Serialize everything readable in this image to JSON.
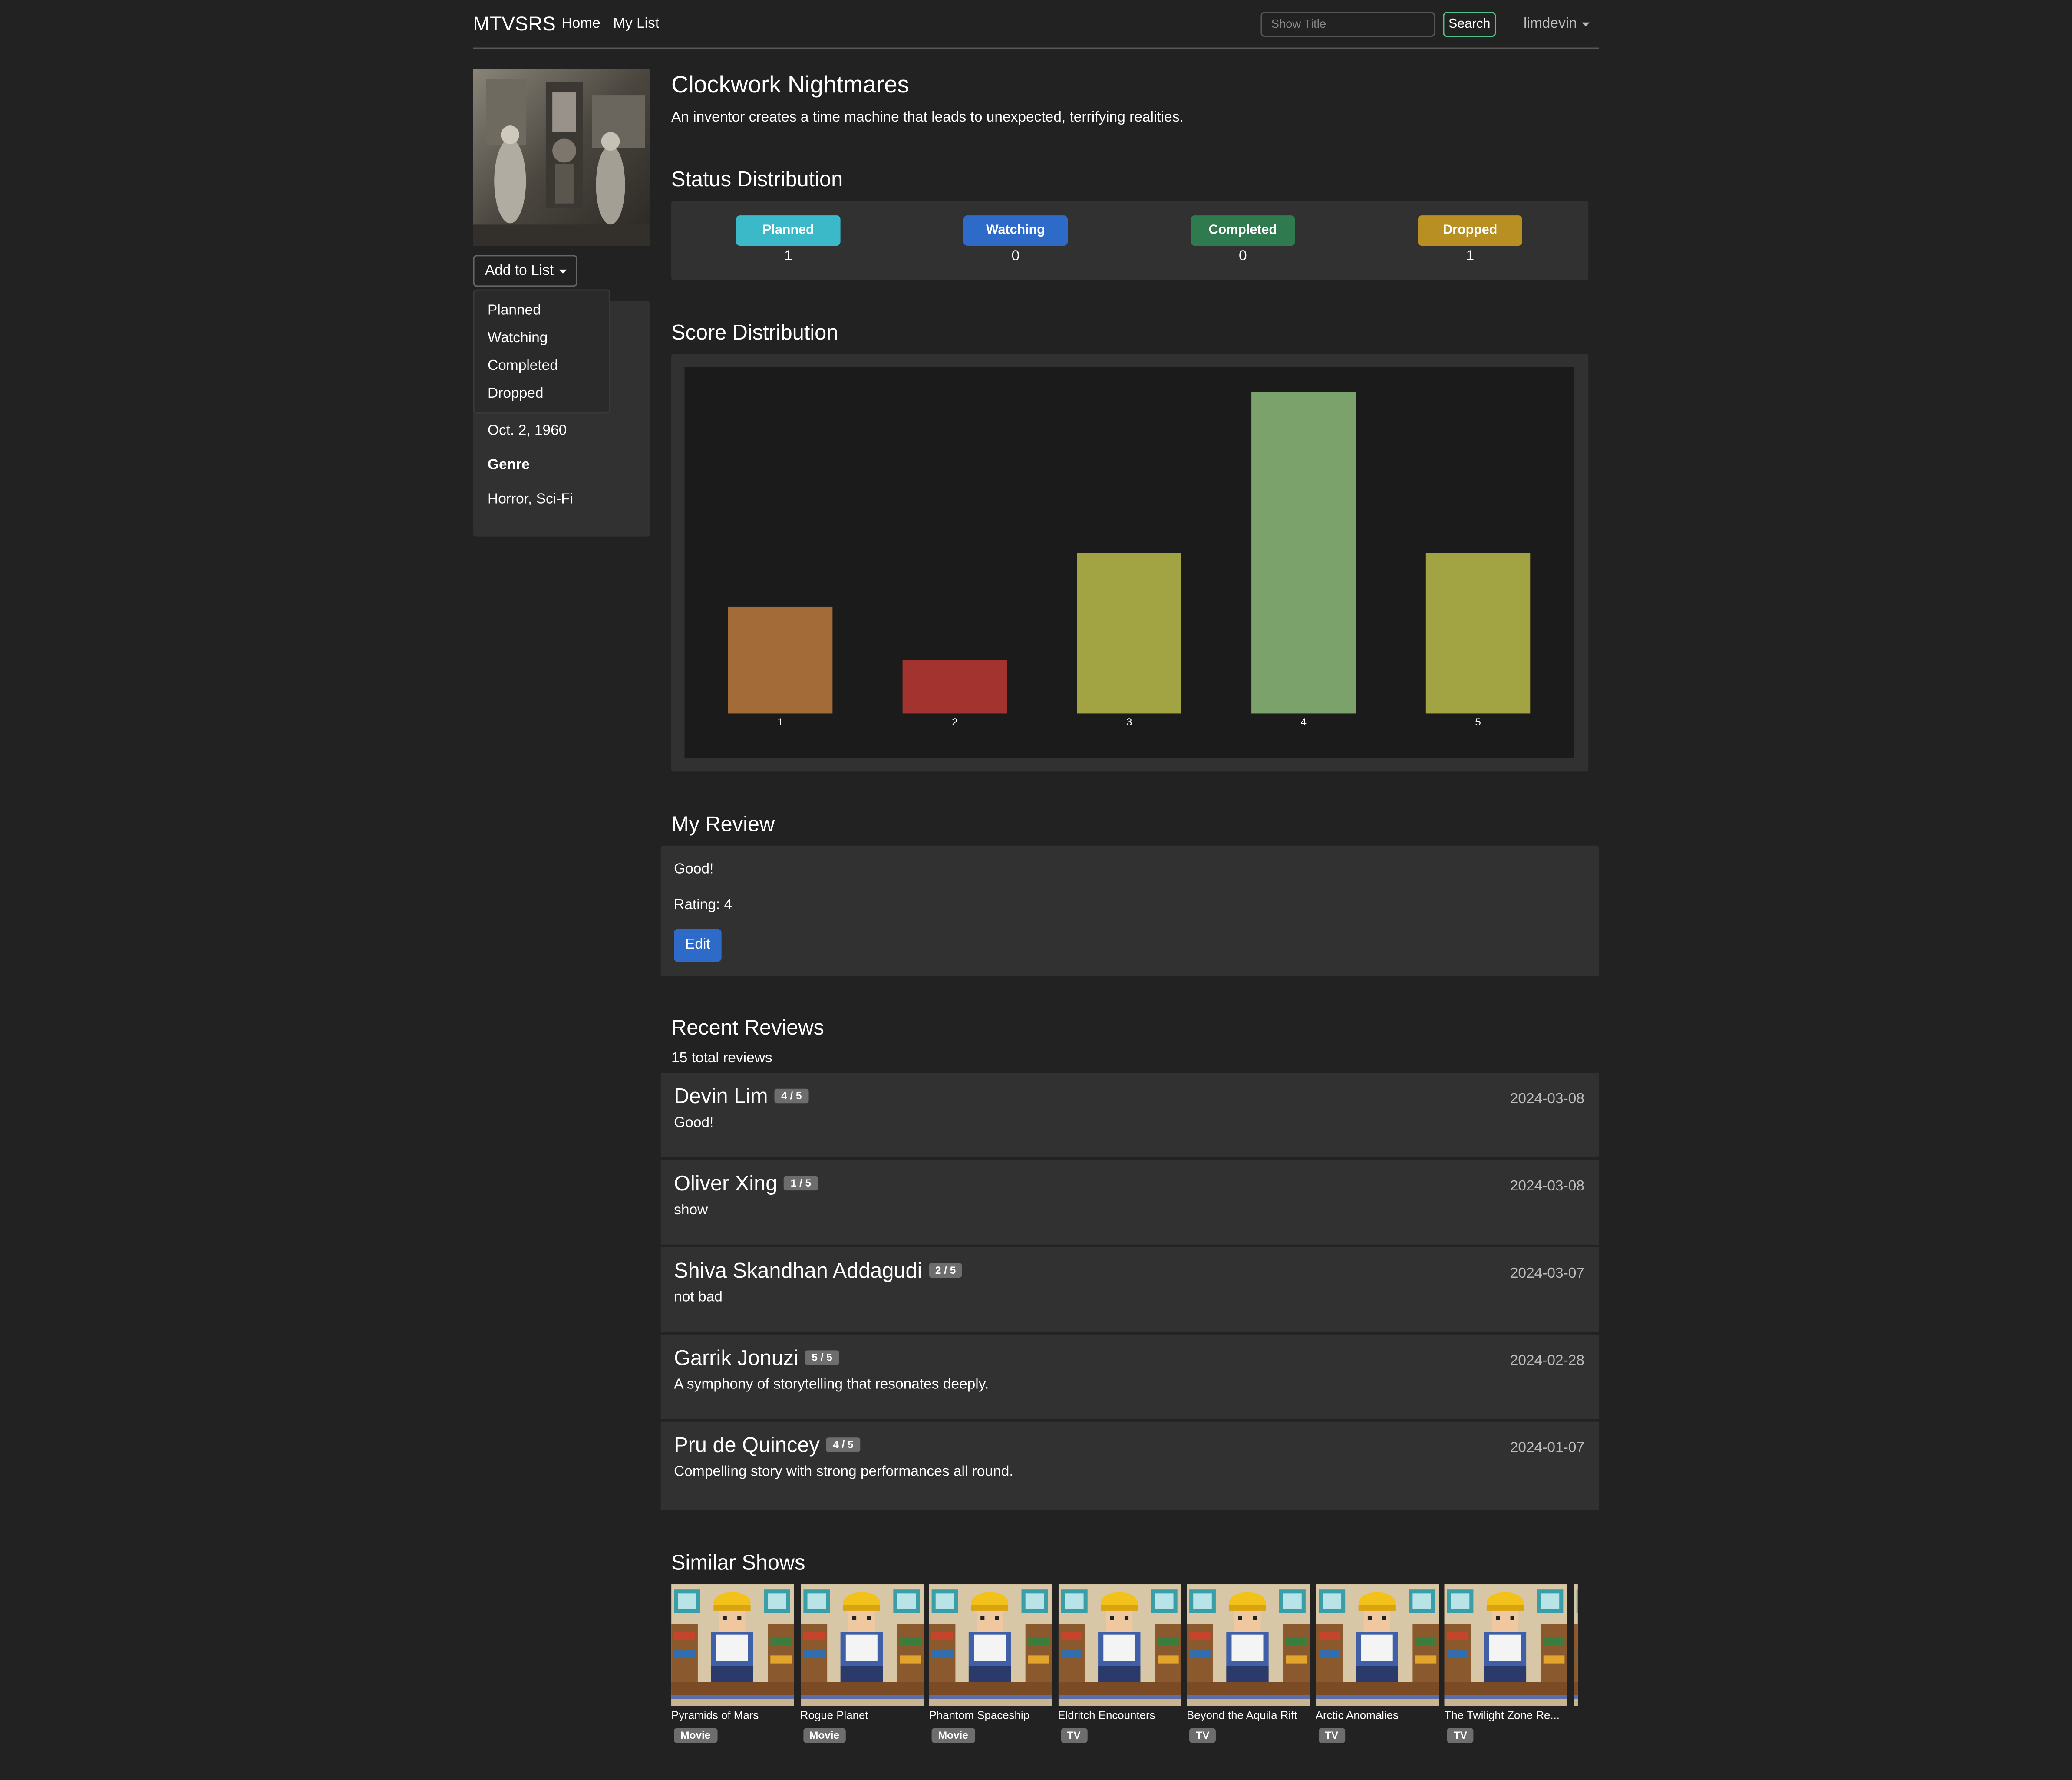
{
  "navbar": {
    "brand": "MTVSRS",
    "links": [
      "Home",
      "My List"
    ],
    "search_placeholder": "Show Title",
    "search_button": "Search",
    "user": "limdevin"
  },
  "show": {
    "title": "Clockwork Nightmares",
    "description": "An inventor creates a time machine that leads to unexpected, terrifying realities.",
    "date": "Oct. 2, 1960",
    "genre_label": "Genre",
    "genre": "Horror, Sci-Fi"
  },
  "add_to_list": {
    "label": "Add to List",
    "options": [
      "Planned",
      "Watching",
      "Completed",
      "Dropped"
    ]
  },
  "status_distribution": {
    "heading": "Status Distribution",
    "items": [
      {
        "label": "Planned",
        "count": "1",
        "color": "#3bb9c9"
      },
      {
        "label": "Watching",
        "count": "0",
        "color": "#2e6ac8"
      },
      {
        "label": "Completed",
        "count": "0",
        "color": "#2f7a4f"
      },
      {
        "label": "Dropped",
        "count": "1",
        "color": "#b78f22"
      }
    ]
  },
  "score_distribution": {
    "heading": "Score Distribution"
  },
  "chart_data": {
    "type": "bar",
    "categories": [
      "1",
      "2",
      "3",
      "4",
      "5"
    ],
    "values": [
      2,
      1,
      3,
      6,
      3
    ],
    "colors": [
      "#a36b37",
      "#a3332f",
      "#a2a444",
      "#7ba26a",
      "#a2a444"
    ],
    "title": "",
    "xlabel": "",
    "ylabel": "",
    "grid": false
  },
  "my_review": {
    "heading": "My Review",
    "text": "Good!",
    "rating": "Rating: 4",
    "edit_label": "Edit"
  },
  "recent_reviews": {
    "heading": "Recent Reviews",
    "total": "15 total reviews",
    "items": [
      {
        "name": "Devin Lim",
        "score": "4 / 5",
        "date": "2024-03-08",
        "text": "Good!"
      },
      {
        "name": "Oliver Xing",
        "score": "1 / 5",
        "date": "2024-03-08",
        "text": "show"
      },
      {
        "name": "Shiva Skandhan Addagudi",
        "score": "2 / 5",
        "date": "2024-03-07",
        "text": "not bad"
      },
      {
        "name": "Garrik Jonuzi",
        "score": "5 / 5",
        "date": "2024-02-28",
        "text": "A symphony of storytelling that resonates deeply."
      },
      {
        "name": "Pru de Quincey",
        "score": "4 / 5",
        "date": "2024-01-07",
        "text": "Compelling story with strong performances all round."
      }
    ]
  },
  "similar_shows": {
    "heading": "Similar Shows",
    "items": [
      {
        "title": "Pyramids of Mars",
        "type": "Movie"
      },
      {
        "title": "Rogue Planet",
        "type": "Movie"
      },
      {
        "title": "Phantom Spaceship",
        "type": "Movie"
      },
      {
        "title": "Eldritch Encounters",
        "type": "TV"
      },
      {
        "title": "Beyond the Aquila Rift",
        "type": "TV"
      },
      {
        "title": "Arctic Anomalies",
        "type": "TV"
      },
      {
        "title": "The Twilight Zone Re...",
        "type": "TV"
      }
    ]
  }
}
